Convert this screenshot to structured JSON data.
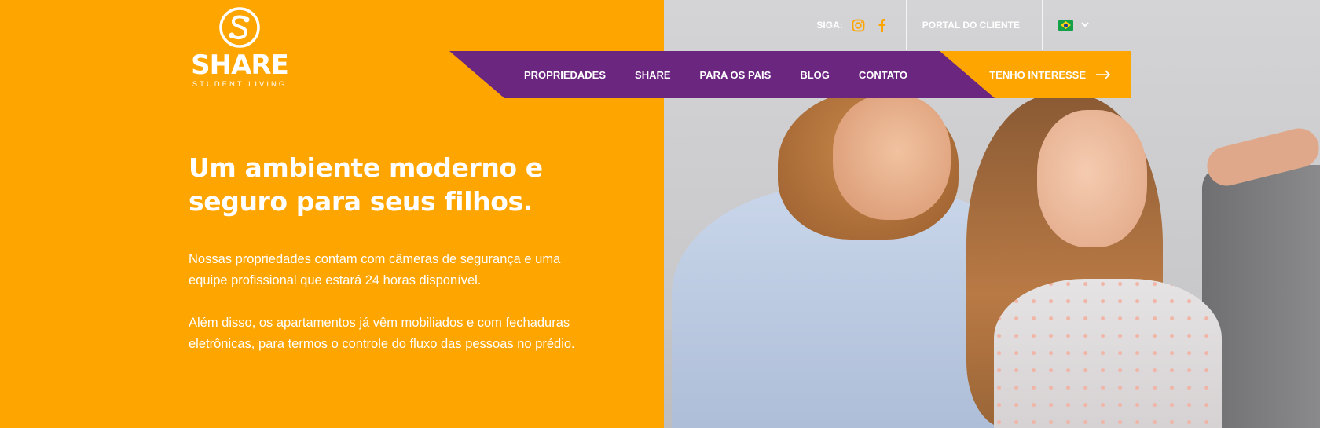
{
  "brand": {
    "name": "SHARE",
    "tagline": "STUDENT LIVING"
  },
  "topbar": {
    "follow_label": "SIGA:",
    "social": [
      "instagram-icon",
      "facebook-icon"
    ],
    "portal_label": "PORTAL DO CLIENTE",
    "language": "pt-BR",
    "language_icon": "brazil-flag-icon"
  },
  "nav": {
    "items": [
      "PROPRIEDADES",
      "SHARE",
      "PARA OS PAIS",
      "BLOG",
      "CONTATO"
    ],
    "cta_label": "TENHO INTERESSE"
  },
  "hero": {
    "title_lines": [
      "Um ambiente moderno e",
      "seguro para seus filhos."
    ],
    "paragraph1_lines": [
      "Nossas propriedades contam com câmeras de segurança e uma",
      "equipe profissional que estará 24 horas disponível."
    ],
    "paragraph2_lines": [
      "Além disso, os apartamentos já vêm mobiliados e com fechaduras",
      "eletrônicas, para termos o controle do fluxo das pessoas no prédio."
    ]
  },
  "colors": {
    "accent": "#FFA500",
    "nav_bg": "#6B2680",
    "text": "#FFFFFF"
  }
}
